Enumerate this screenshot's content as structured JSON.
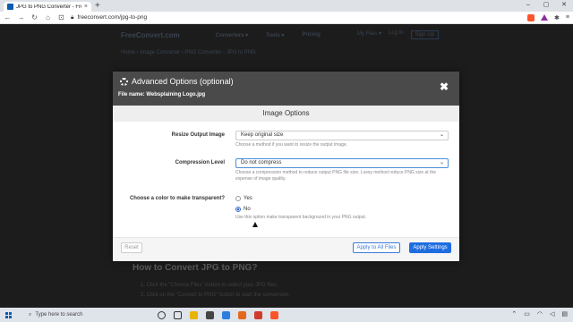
{
  "browser": {
    "tab_title": "JPG to PNG Converter - FreeConve",
    "tab_close": "×",
    "new_tab": "+",
    "url": "freeconvert.com/jpg-to-png",
    "win_min": "–",
    "win_max": "▢",
    "win_close": "✕"
  },
  "site": {
    "logo": "FreeConvert.com",
    "menu": [
      "Converters ▾",
      "Tools ▾",
      "Pricing"
    ],
    "my_files": "My Files ▾",
    "login": "Log In",
    "signup": "Sign Up",
    "breadcrumb": "Home › Image Converter › PNG Converter › JPG to PNG",
    "howto_title": "How to Convert JPG to PNG?",
    "howto_steps": [
      "1. Click the \"Choose Files\" button to select your JPG files.",
      "2. Click on the \"Convert to PNG\" button to start the conversion."
    ]
  },
  "modal": {
    "title": "Advanced Options (optional)",
    "file_name": "File name: Websplaining Logo.jpg",
    "close": "✖",
    "section": "Image Options",
    "resize": {
      "label": "Resize Output Image",
      "value": "Keep original size",
      "help": "Choose a method if you want to resize the output image."
    },
    "compression": {
      "label": "Compression Level",
      "value": "Do not compress",
      "help": "Choose a compression method to reduce output PNG file size. Lossy method reduce PNG size at the expense of image quality."
    },
    "transparent": {
      "label": "Choose a color to make transparent?",
      "options": [
        "Yes",
        "No"
      ],
      "selected": "No",
      "help": "Use this option make transparent background in your PNG output."
    },
    "buttons": {
      "reset": "Reset",
      "apply_all": "Apply to All Files",
      "apply": "Apply Settings"
    }
  },
  "taskbar": {
    "search_placeholder": "Type here to search"
  },
  "colors": {
    "modal_header": "#4a4a4a",
    "primary": "#1e6de0"
  }
}
